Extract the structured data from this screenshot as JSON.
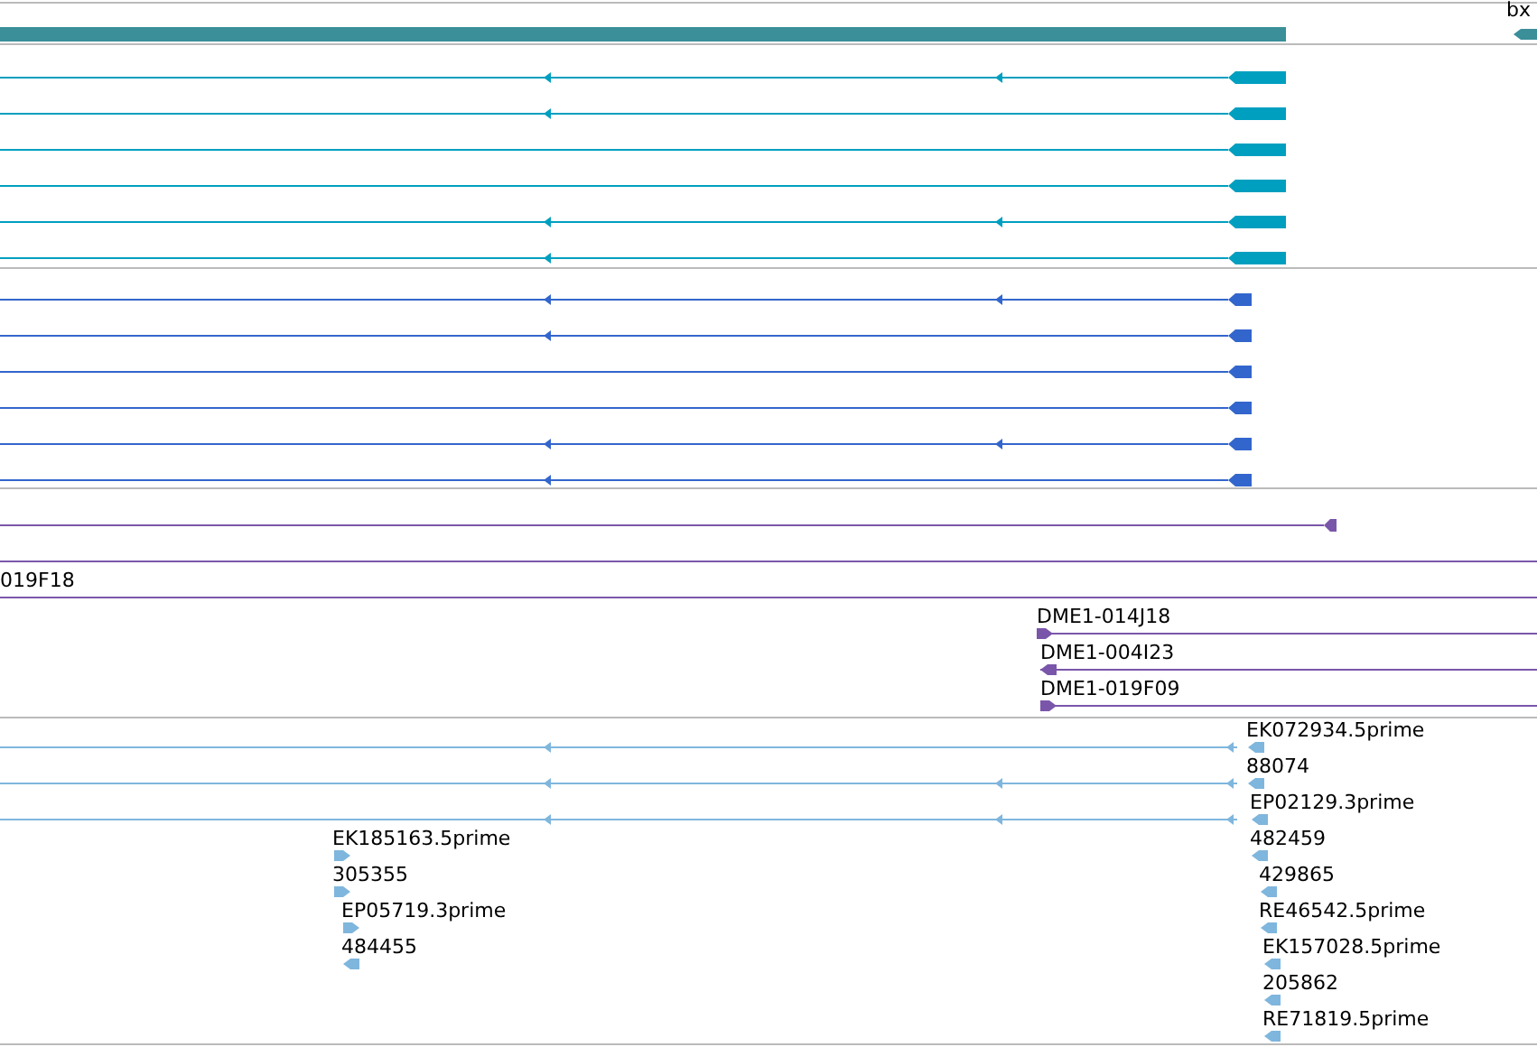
{
  "tracks": [
    {
      "kind": "gene",
      "color": "#3a8f99",
      "features": [
        {
          "label": "bx",
          "forward": false
        }
      ]
    },
    {
      "kind": "transcripts",
      "color": "#009fc0",
      "features": [
        {
          "forward": false
        },
        {
          "forward": false
        },
        {
          "forward": false
        },
        {
          "forward": false
        },
        {
          "forward": false
        },
        {
          "forward": false
        }
      ]
    },
    {
      "kind": "transcripts",
      "color": "#3366cc",
      "features": [
        {
          "forward": false
        },
        {
          "forward": false
        },
        {
          "forward": false
        },
        {
          "forward": false
        },
        {
          "forward": false
        },
        {
          "forward": false
        }
      ]
    },
    {
      "kind": "clones",
      "color": "#7a56aa",
      "features": [
        {
          "forward": false
        },
        {
          "label": "019F18"
        },
        {
          "label": "DME1-014J18",
          "forward": true
        },
        {
          "label": "DME1-004I23",
          "forward": false
        },
        {
          "label": "DME1-019F09",
          "forward": true
        }
      ]
    },
    {
      "kind": "ests",
      "color": "#7fb6dd",
      "features": [
        {
          "forward": false
        },
        {
          "forward": false
        },
        {
          "forward": false
        },
        {
          "label": "EK072934.5prime",
          "forward": false
        },
        {
          "label": "88074",
          "forward": false
        },
        {
          "label": "EP02129.3prime",
          "forward": false
        },
        {
          "label": "EK185163.5prime",
          "forward": true
        },
        {
          "label": "482459",
          "forward": false
        },
        {
          "label": "305355",
          "forward": true
        },
        {
          "label": "429865",
          "forward": false
        },
        {
          "label": "EP05719.3prime",
          "forward": true
        },
        {
          "label": "RE46542.5prime",
          "forward": false
        },
        {
          "label": "484455",
          "forward": false
        },
        {
          "label": "EK157028.5prime",
          "forward": false
        },
        {
          "label": "205862",
          "forward": false
        },
        {
          "label": "RE71819.5prime",
          "forward": false
        }
      ]
    }
  ]
}
